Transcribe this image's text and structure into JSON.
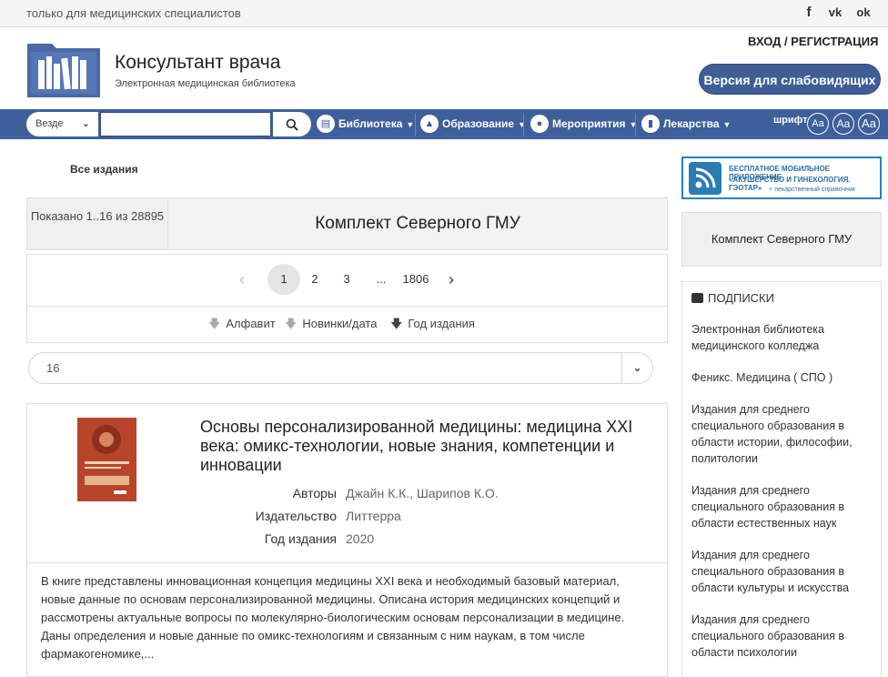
{
  "topbar": {
    "note": "только для медицинских специалистов",
    "social": [
      "f",
      "vk",
      "ok"
    ]
  },
  "header": {
    "title": "Консультант врача",
    "subtitle": "Электронная медицинская библиотека",
    "login": "ВХОД / РЕГИСТРАЦИЯ",
    "accessibility_button": "Версия для слабовидящих"
  },
  "nav": {
    "scope": "Везде",
    "search_value": "",
    "items": [
      {
        "label": "Библиотека",
        "icon": "book-icon"
      },
      {
        "label": "Образование",
        "icon": "graduation-cap-icon"
      },
      {
        "label": "Мероприятия",
        "icon": "person-icon"
      },
      {
        "label": "Лекарства",
        "icon": "medicine-bottle-icon"
      }
    ],
    "font_label": "шрифт",
    "font_buttons": [
      "Aa",
      "Aa",
      "Aa"
    ]
  },
  "main": {
    "breadcrumb": "Все издания",
    "shown": "Показано 1..16 из 28895",
    "collection_title": "Комплект Северного ГМУ",
    "pager": [
      "1",
      "2",
      "3",
      "...",
      "1806"
    ],
    "sort": [
      "Алфавит",
      "Новинки/дата",
      "Год издания"
    ],
    "per_page": "16",
    "book": {
      "title": "Основы персонализированной медицины: медицина XXI века: омикс-технологии, новые знания, компетенции и инновации",
      "fields": [
        {
          "label": "Авторы",
          "value": "Джайн К.К., Шарипов К.О."
        },
        {
          "label": "Издательство",
          "value": "Литтерра"
        },
        {
          "label": "Год издания",
          "value": "2020"
        }
      ],
      "description": "В книге представлены инновационная концепция медицины XXI века и необходимый базовый материал, новые данные по основам персонализированной медицины. Описана история медицинских концепций и рассмотрены актуальные вопросы по молекулярно-биологическим основам персонализации в медицине. Даны определения и новые данные по омикс-технологиям и связанным с ним наукам, в том числе фармакогеномике,..."
    }
  },
  "sidebar": {
    "promo": {
      "line1": "БЕСПЛАТНОЕ МОБИЛЬНОЕ ПРИЛОЖЕНИЕ",
      "line2": "«АКУШЕРСТВО И ГИНЕКОЛОГИЯ. ГЭОТАР»",
      "line3": "+ лекарственный справочник"
    },
    "collection": "Комплект Северного ГМУ",
    "subscriptions_title": "ПОДПИСКИ",
    "subscriptions": [
      "Электронная библиотека медицинского колледжа",
      "Феникс. Медицина ( СПО )",
      "Издания для среднего специального образования в области истории, философии, политологии",
      "Издания для среднего специального образования в области естественных наук",
      "Издания для среднего специального образования в области культуры и искусства",
      "Издания для среднего специального образования в области психологии"
    ]
  },
  "colors": {
    "nav": "#3e5f9a",
    "accent_button": "#3f5e96",
    "promo_border": "#2a82b9"
  }
}
